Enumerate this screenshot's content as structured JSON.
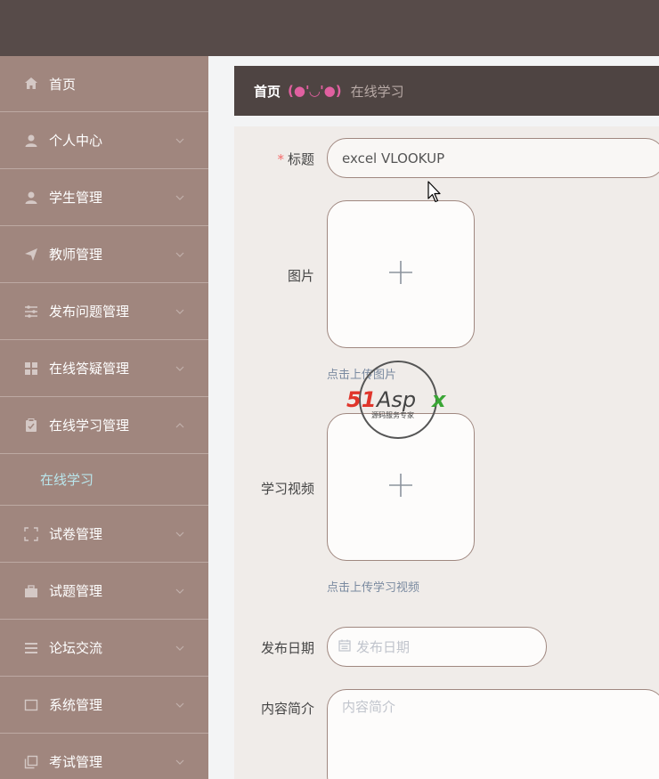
{
  "sidebar": {
    "items": [
      {
        "label": "首页",
        "icon": "home-icon"
      },
      {
        "label": "个人中心",
        "icon": "user-icon"
      },
      {
        "label": "学生管理",
        "icon": "user-icon"
      },
      {
        "label": "教师管理",
        "icon": "send-icon"
      },
      {
        "label": "发布问题管理",
        "icon": "sliders-icon"
      },
      {
        "label": "在线答疑管理",
        "icon": "grid-icon"
      },
      {
        "label": "在线学习管理",
        "icon": "clipboard-icon"
      },
      {
        "label": "试卷管理",
        "icon": "frame-icon"
      },
      {
        "label": "试题管理",
        "icon": "briefcase-icon"
      },
      {
        "label": "论坛交流",
        "icon": "list-icon"
      },
      {
        "label": "系统管理",
        "icon": "window-icon"
      },
      {
        "label": "考试管理",
        "icon": "copy-icon"
      }
    ],
    "submenu": {
      "label": "在线学习"
    }
  },
  "breadcrumb": {
    "home": "首页",
    "emoji": "(●'◡'●)",
    "current": "在线学习"
  },
  "form": {
    "title_label": "标题",
    "title_required_mark": "*",
    "title_value": "excel VLOOKUP",
    "image_label": "图片",
    "image_hint": "点击上传图片",
    "video_label": "学习视频",
    "video_hint": "点击上传学习视频",
    "date_label": "发布日期",
    "date_placeholder": "发布日期",
    "intro_label": "内容简介",
    "intro_placeholder": "内容简介"
  },
  "watermark": {
    "brand": "51Aspx",
    "tagline": "源码服务专家"
  },
  "colors": {
    "topbar": "#574b49",
    "sidebar": "#a0867e",
    "breadcrumb_bg": "#4e4442",
    "accent_pink": "#e060a0",
    "submenu_active": "#b9e6ec"
  }
}
